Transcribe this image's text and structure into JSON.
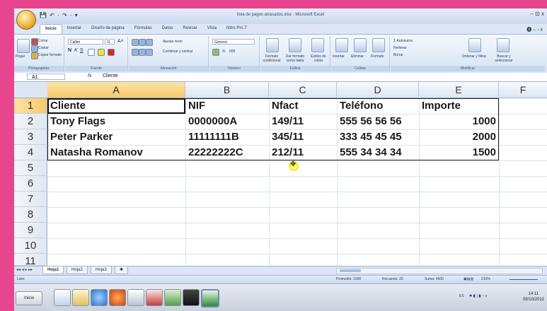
{
  "window": {
    "title": "lista de pagos atrasados.xlsx - Microsoft Excel",
    "controls": "–  ⊡  x"
  },
  "qat": "💾 ↶ · ↷ · ▾",
  "ribbon_tabs": [
    "Inicio",
    "Insertar",
    "Diseño de página",
    "Fórmulas",
    "Datos",
    "Revisar",
    "Vista",
    "Nitro Pro 7"
  ],
  "ribbon_help": "⓿ – ▫ x",
  "ribbon": {
    "clipboard": {
      "paste": "Pegar",
      "cut": "Cortar",
      "copy": "Copiar",
      "format_painter": "Copiar formato",
      "label": "Portapapeles"
    },
    "font": {
      "name": "Calibri",
      "size": "11",
      "bold": "N",
      "italic": "K",
      "underline": "S",
      "label": "Fuente"
    },
    "alignment": {
      "wrap": "Ajustar texto",
      "merge": "Combinar y centrar",
      "label": "Alineación"
    },
    "number": {
      "format": "General",
      "percent": "%",
      "thousands": "000",
      "label": "Número"
    },
    "styles": {
      "conditional": "Formato condicional",
      "as_table": "Dar formato como tabla",
      "cell_styles": "Estilos de celda",
      "label": "Estilos"
    },
    "cells": {
      "insert": "Insertar",
      "delete": "Eliminar",
      "format": "Formato",
      "label": "Celdas"
    },
    "editing": {
      "autosum": "Σ Autosuma",
      "fill": "Rellenar",
      "clear": "Borrar",
      "sort": "Ordenar y filtrar",
      "find": "Buscar y seleccionar",
      "label": "Modificar"
    }
  },
  "formula_bar": {
    "name_box": "A1",
    "fx": "fx",
    "content": "Cliente"
  },
  "columns": [
    "A",
    "B",
    "C",
    "D",
    "E",
    "F"
  ],
  "row_numbers": [
    "1",
    "2",
    "3",
    "4",
    "5",
    "6",
    "7",
    "8",
    "9",
    "10",
    "11"
  ],
  "table": {
    "headers": [
      "Cliente",
      "NIF",
      "Nfact",
      "Teléfono",
      "Importe"
    ],
    "rows": [
      [
        "Tony Flags",
        "0000000A",
        "149/11",
        "555 56 56 56",
        "1000"
      ],
      [
        "Peter Parker",
        "11111111B",
        "345/11",
        "333 45 45 45",
        "2000"
      ],
      [
        "Natasha Romanov",
        "22222222C",
        "212/11",
        "555 34 34 34",
        "1500"
      ]
    ]
  },
  "sheet_tabs": [
    "Hoja1",
    "Hoja2",
    "Hoja3"
  ],
  "status": {
    "mode": "Listo",
    "average": "Promedio: 1500",
    "count": "Recuento: 20",
    "sum": "Suma: 4500",
    "zoom": "210%"
  },
  "taskbar": {
    "start": "Inicio",
    "lang": "ES",
    "time": "14:11",
    "date": "09/10/2012"
  },
  "colors": {
    "frame": "#e8458f",
    "selection_header": "#f6c96a",
    "ribbon": "#d6e3f3"
  }
}
